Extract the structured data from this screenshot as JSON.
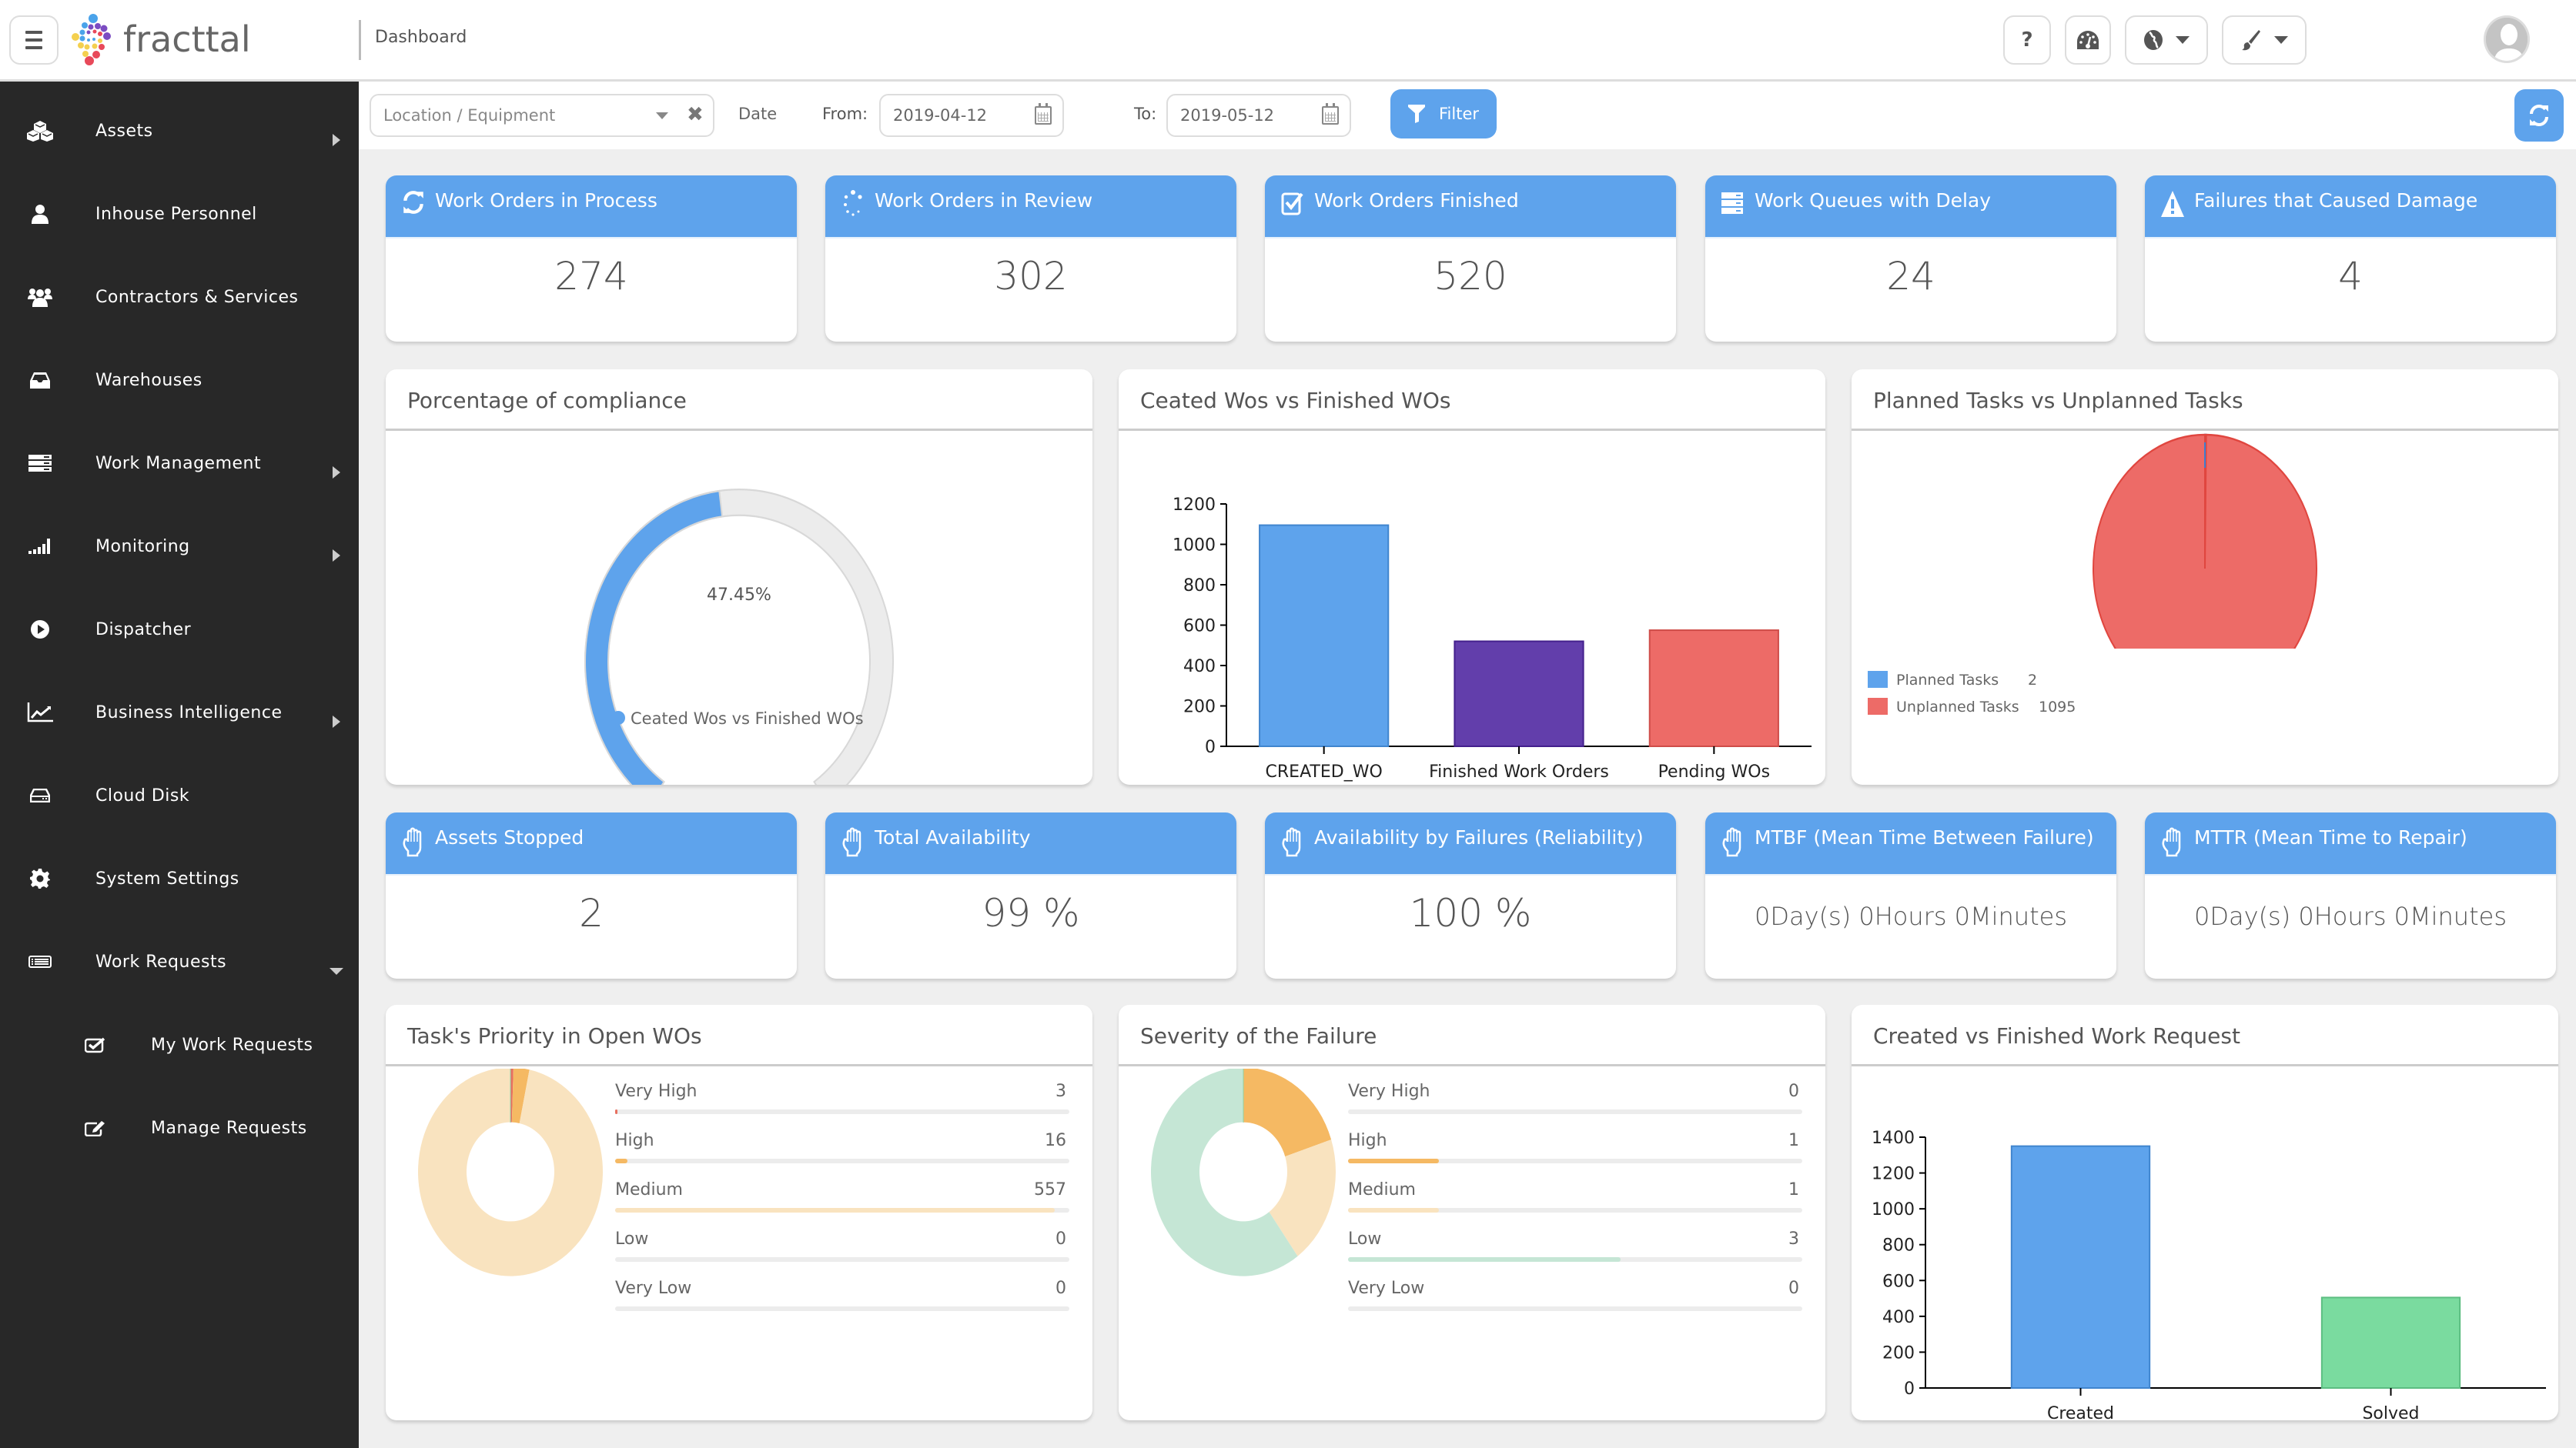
{
  "app": {
    "brand": "fracttal",
    "breadcrumb": "Dashboard",
    "accent_color": "#5ea3ec"
  },
  "toolbar": {
    "help_icon": "question-icon",
    "dashboard_icon": "tachometer-icon",
    "language_icon": "globe-icon",
    "theme_icon": "paintbrush-icon"
  },
  "sidebar": {
    "items": [
      {
        "label": "Assets",
        "icon": "cubes-icon",
        "has_submenu": true
      },
      {
        "label": "Inhouse Personnel",
        "icon": "user-icon",
        "has_submenu": false
      },
      {
        "label": "Contractors & Services",
        "icon": "users-icon",
        "has_submenu": false
      },
      {
        "label": "Warehouses",
        "icon": "inbox-icon",
        "has_submenu": false
      },
      {
        "label": "Work Management",
        "icon": "server-icon",
        "has_submenu": true
      },
      {
        "label": "Monitoring",
        "icon": "signal-icon",
        "has_submenu": true
      },
      {
        "label": "Dispatcher",
        "icon": "play-circle-icon",
        "has_submenu": false
      },
      {
        "label": "Business Intelligence",
        "icon": "line-chart-icon",
        "has_submenu": true
      },
      {
        "label": "Cloud Disk",
        "icon": "hdd-icon",
        "has_submenu": false
      },
      {
        "label": "System Settings",
        "icon": "gear-icon",
        "has_submenu": false
      },
      {
        "label": "Work Requests",
        "icon": "list-alt-icon",
        "has_submenu": true,
        "expanded": true
      }
    ],
    "subitems": [
      {
        "label": "My Work Requests",
        "icon": "check-square-icon"
      },
      {
        "label": "Manage Requests",
        "icon": "edit-icon"
      }
    ]
  },
  "filters": {
    "location_placeholder": "Location / Equipment",
    "date_label": "Date",
    "from_label": "From:",
    "from_value": "2019-04-12",
    "to_label": "To:",
    "to_value": "2019-05-12",
    "filter_label": "Filter"
  },
  "stats_top": [
    {
      "title": "Work Orders in Process",
      "value": "274",
      "icon": "refresh-icon"
    },
    {
      "title": "Work Orders in Review",
      "value": "302",
      "icon": "spinner-icon"
    },
    {
      "title": "Work Orders Finished",
      "value": "520",
      "icon": "check-square-icon"
    },
    {
      "title": "Work Queues with Delay",
      "value": "24",
      "icon": "server-icon"
    },
    {
      "title": "Failures that Caused Damage",
      "value": "4",
      "icon": "warning-icon"
    }
  ],
  "stats_bottom": [
    {
      "title": "Assets Stopped",
      "value": "2",
      "icon": "hand-stop-icon"
    },
    {
      "title": "Total Availability",
      "value": "99 %",
      "icon": "hand-stop-icon"
    },
    {
      "title": "Availability by Failures (Reliability)",
      "value": "100 %",
      "icon": "hand-stop-icon"
    },
    {
      "title": "MTBF (Mean Time Between Failure)",
      "value": "0Day(s) 0Hours 0Minutes",
      "icon": "hand-stop-icon"
    },
    {
      "title": "MTTR (Mean Time to Repair)",
      "value": "0Day(s) 0Hours 0Minutes",
      "icon": "hand-stop-icon"
    }
  ],
  "chart_data": [
    {
      "type": "gauge",
      "title": "Porcentage of compliance",
      "value": 47.45,
      "label": "47.45%",
      "max": 100,
      "legend": [
        "Ceated Wos vs Finished WOs"
      ],
      "colors": {
        "fill": "#5ea3ec",
        "track": "#ececec"
      }
    },
    {
      "type": "bar",
      "title": "Ceated Wos vs Finished WOs",
      "categories": [
        "CREATED_WO",
        "Finished Work Orders",
        "Pending WOs"
      ],
      "values": [
        1095,
        520,
        575
      ],
      "colors": [
        "#5ea3ec",
        "#623eab",
        "#ed6b67"
      ],
      "ylim": [
        0,
        1200
      ],
      "yticks": [
        0,
        200,
        400,
        600,
        800,
        1000,
        1200
      ],
      "xlabel": "",
      "ylabel": ""
    },
    {
      "type": "pie",
      "title": "Planned Tasks vs Unplanned Tasks",
      "categories": [
        "Planned Tasks",
        "Unplanned Tasks"
      ],
      "values": [
        2,
        1095
      ],
      "colors": [
        "#5ea3ec",
        "#ed6b67"
      ],
      "legend": "bottom-left"
    },
    {
      "type": "pie",
      "title": "Task's Priority in Open WOs",
      "donut": true,
      "categories": [
        "Very High",
        "High",
        "Medium",
        "Low",
        "Very Low"
      ],
      "values": [
        3,
        16,
        557,
        0,
        0
      ],
      "colors": [
        "#e8705f",
        "#f5b963",
        "#f9e3bf",
        "#c5e6d5",
        "#8fd3a8"
      ],
      "legend": "right"
    },
    {
      "type": "pie",
      "title": "Severity of the Failure",
      "donut": true,
      "categories": [
        "Very High",
        "High",
        "Medium",
        "Low",
        "Very Low"
      ],
      "values": [
        0,
        1,
        1,
        3,
        0
      ],
      "colors": [
        "#e8705f",
        "#f5b963",
        "#f9e3bf",
        "#c5e6d5",
        "#8fd3a8"
      ],
      "legend": "right"
    },
    {
      "type": "bar",
      "title": "Created vs Finished Work Request",
      "categories": [
        "Created",
        "Solved"
      ],
      "values": [
        1350,
        505
      ],
      "colors": [
        "#5ea3ec",
        "#7adb9f"
      ],
      "ylim": [
        0,
        1400
      ],
      "yticks": [
        0,
        200,
        400,
        600,
        800,
        1000,
        1200,
        1400
      ],
      "xlabel": "",
      "ylabel": ""
    }
  ]
}
